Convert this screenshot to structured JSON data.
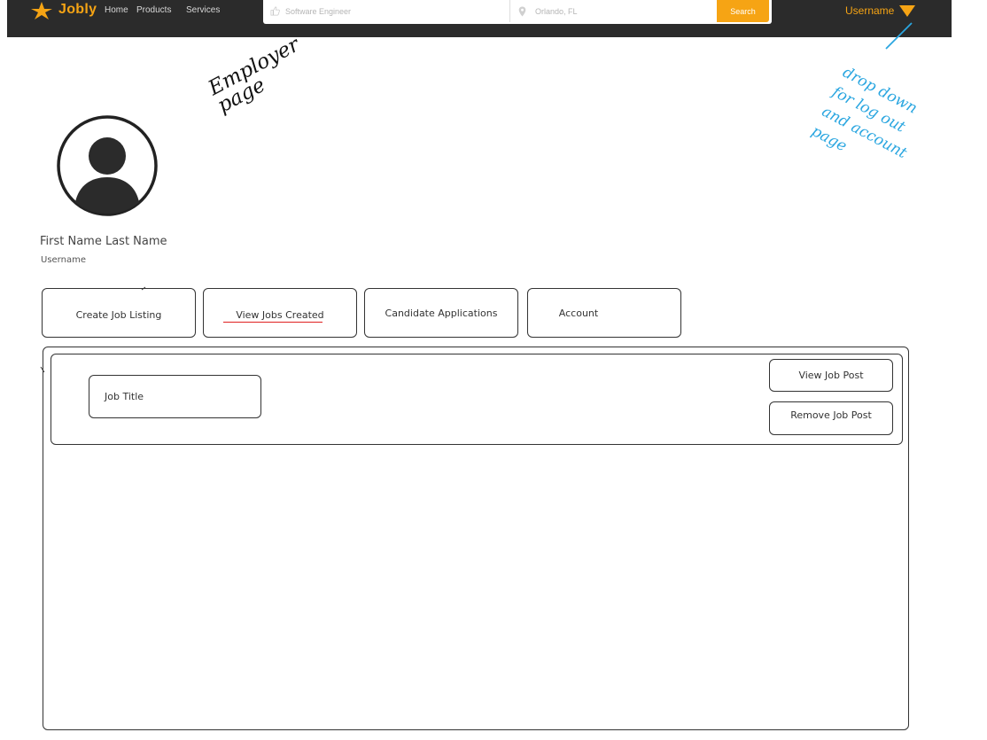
{
  "nav": {
    "brand": "Jobly",
    "links": [
      "Home",
      "Products",
      "Services"
    ],
    "search": {
      "keyword_placeholder": "Software Engineer",
      "location_placeholder": "Orlando, FL",
      "button_label": "Search"
    },
    "user_label": "Username",
    "accent_color": "#f6a414",
    "bar_color": "#2b2b2b"
  },
  "profile": {
    "full_name": "First Name Last Name",
    "username": "Username",
    "avatar_icon": "user-avatar-icon"
  },
  "tabs": [
    {
      "label": "Create Job Listing"
    },
    {
      "label": "View Jobs Created",
      "active": true
    },
    {
      "label": "Candidate Applications"
    },
    {
      "label": "Account"
    }
  ],
  "job_card": {
    "title": "Job Title",
    "view_button": "View Job Post",
    "remove_button": "Remove Job Post"
  },
  "annotations": {
    "page_note": "Employer page",
    "dropdown_note": "drop down for log out and account page",
    "page_note_color": "#111111",
    "dropdown_note_color": "#2aa6e0"
  }
}
